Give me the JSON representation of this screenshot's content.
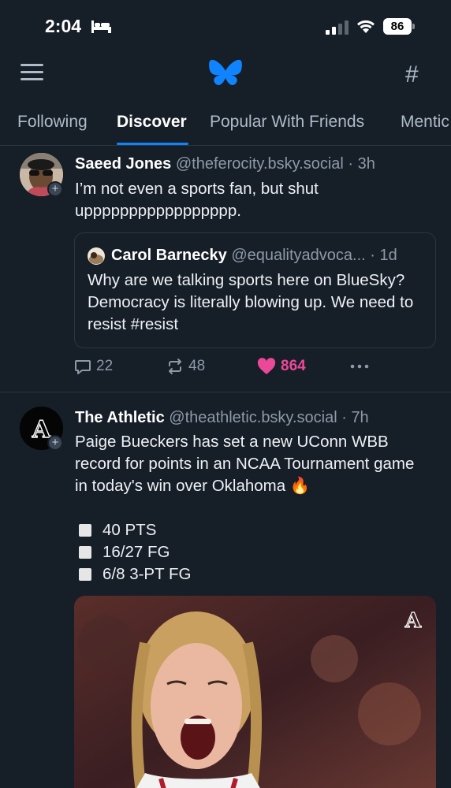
{
  "status_bar": {
    "time": "2:04",
    "battery": "86"
  },
  "nav": {
    "tabs": [
      {
        "label": "Following"
      },
      {
        "label": "Discover"
      },
      {
        "label": "Popular With Friends"
      },
      {
        "label": "Mentic"
      }
    ],
    "active_tab": "Discover"
  },
  "colors": {
    "background": "#161e27",
    "accent": "#1083fe",
    "like": "#ec4899",
    "muted": "#8d9aa8"
  },
  "posts": [
    {
      "author": "Saeed Jones",
      "handle": "@theferocity.bsky.social",
      "dot": "·",
      "time": "3h",
      "text": "I’m not even a sports fan, but shut uppppppppppppppppp.",
      "quote": {
        "author": "Carol Barnecky",
        "handle": "@equalityadvoca...",
        "dot": "·",
        "time": "1d",
        "text": "Why are we talking sports here on BlueSky? Democracy is literally blowing up. We need to resist #resist"
      },
      "replies": "22",
      "reposts": "48",
      "likes": "864"
    },
    {
      "author": "The Athletic",
      "handle": "@theathletic.bsky.social",
      "dot": "·",
      "time": "7h",
      "text": "Paige Bueckers has set a new UConn WBB record for points in an NCAA Tournament game in today's win over Oklahoma 🔥",
      "stats": [
        "40 PTS",
        "16/27 FG",
        "6/8 3-PT FG"
      ],
      "image_watermark": "A"
    }
  ]
}
